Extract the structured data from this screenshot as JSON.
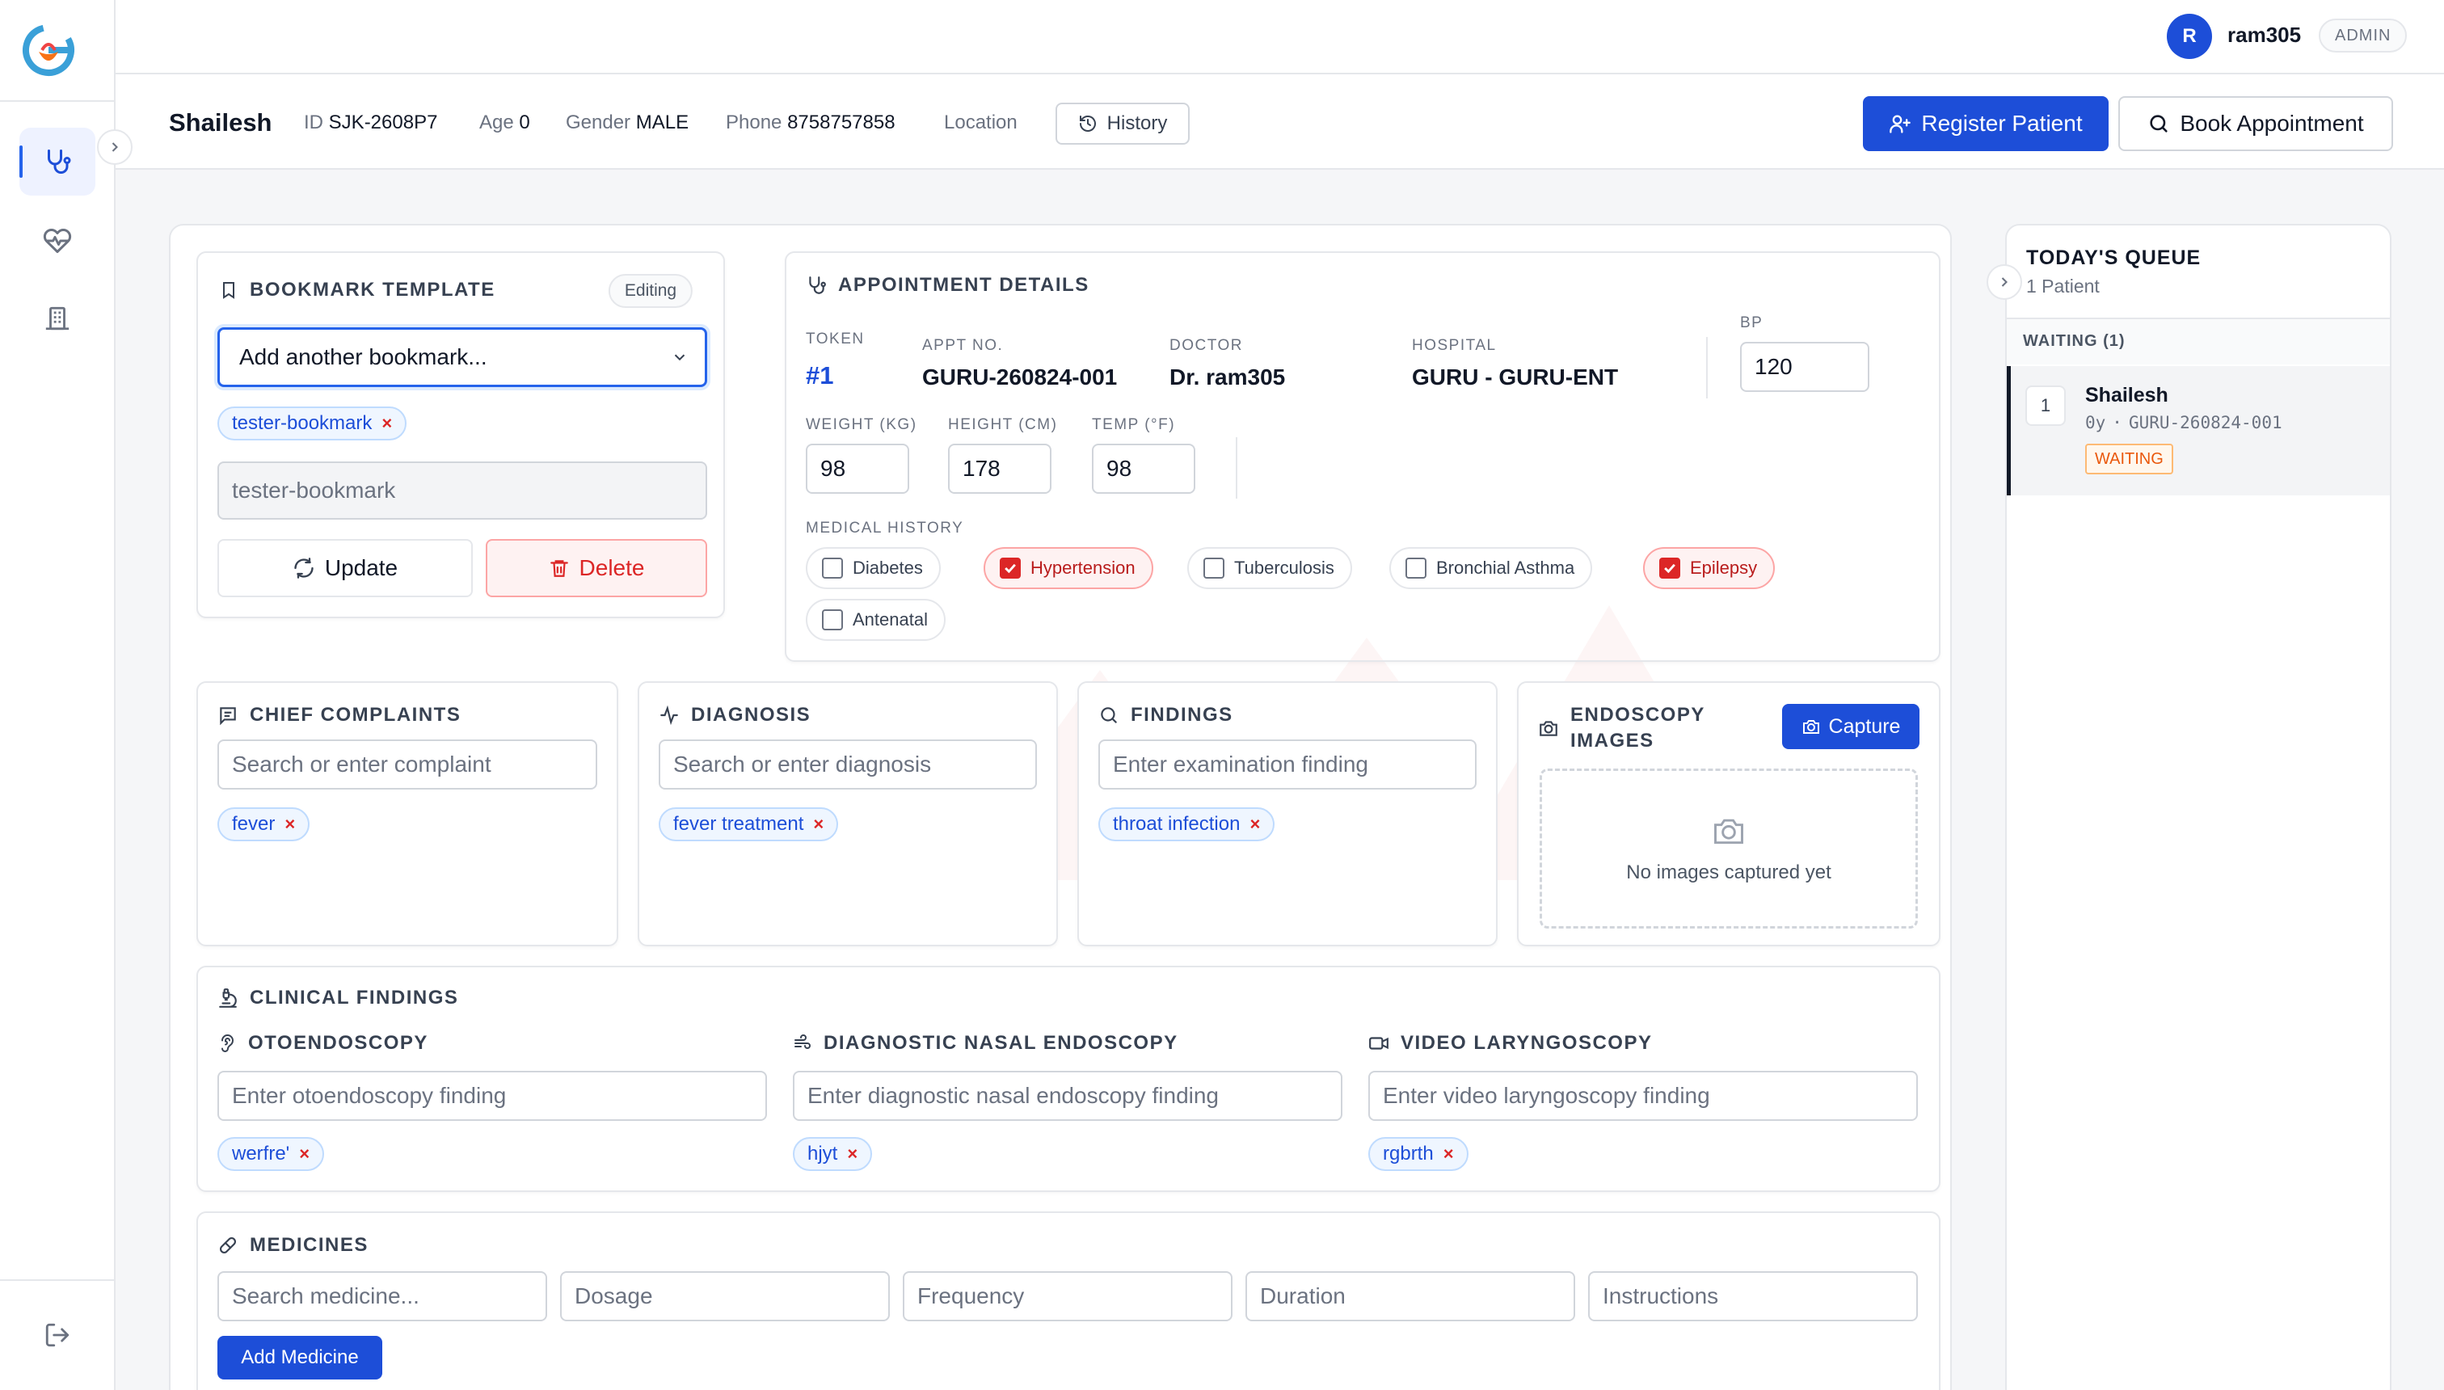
{
  "topbar": {
    "avatar_initial": "R",
    "user_name": "ram305",
    "role": "ADMIN"
  },
  "patient": {
    "name": "Shailesh",
    "id_label": "ID",
    "id": "SJK-2608P7",
    "age_label": "Age",
    "age": "0",
    "gender_label": "Gender",
    "gender": "MALE",
    "phone_label": "Phone",
    "phone": "8758757858",
    "location_label": "Location",
    "history_btn": "History",
    "register_btn": "Register Patient",
    "book_btn": "Book Appointment"
  },
  "bookmark": {
    "title": "BOOKMARK TEMPLATE",
    "badge": "Editing",
    "select_value": "Add another bookmark...",
    "chip": "tester-bookmark",
    "name_value": "tester-bookmark",
    "update_btn": "Update",
    "delete_btn": "Delete"
  },
  "appointment": {
    "title": "APPOINTMENT DETAILS",
    "token_label": "TOKEN",
    "token": "#1",
    "appt_label": "APPT NO.",
    "appt_no": "GURU-260824-001",
    "doctor_label": "DOCTOR",
    "doctor": "Dr. ram305",
    "hospital_label": "HOSPITAL",
    "hospital": "GURU - GURU-ENT",
    "bp_label": "BP",
    "bp": "120",
    "weight_label": "WEIGHT (KG)",
    "weight": "98",
    "height_label": "HEIGHT (CM)",
    "height": "178",
    "temp_label": "TEMP (°F)",
    "temp": "98",
    "history_label": "MEDICAL HISTORY",
    "history": [
      {
        "label": "Diabetes",
        "checked": false
      },
      {
        "label": "Hypertension",
        "checked": true
      },
      {
        "label": "Tuberculosis",
        "checked": false
      },
      {
        "label": "Bronchial Asthma",
        "checked": false
      },
      {
        "label": "Epilepsy",
        "checked": true
      },
      {
        "label": "Antenatal",
        "checked": false
      }
    ]
  },
  "complaints": {
    "title": "CHIEF COMPLAINTS",
    "placeholder": "Search or enter complaint",
    "chip": "fever"
  },
  "diagnosis": {
    "title": "DIAGNOSIS",
    "placeholder": "Search or enter diagnosis",
    "chip": "fever treatment"
  },
  "findings": {
    "title": "FINDINGS",
    "placeholder": "Enter examination finding",
    "chip": "throat infection"
  },
  "endoscopy": {
    "title_line1": "ENDOSCOPY",
    "title_line2": "IMAGES",
    "capture_btn": "Capture",
    "empty_text": "No images captured yet"
  },
  "clinical": {
    "title": "CLINICAL FINDINGS",
    "oto_title": "OTOENDOSCOPY",
    "oto_placeholder": "Enter otoendoscopy finding",
    "oto_chip": "werfre'",
    "nasal_title": "DIAGNOSTIC NASAL ENDOSCOPY",
    "nasal_placeholder": "Enter diagnostic nasal endoscopy finding",
    "nasal_chip": "hjyt",
    "laryngo_title": "VIDEO LARYNGOSCOPY",
    "laryngo_placeholder": "Enter video laryngoscopy finding",
    "laryngo_chip": "rgbrth"
  },
  "medicines": {
    "title": "MEDICINES",
    "search_placeholder": "Search medicine...",
    "dosage_placeholder": "Dosage",
    "frequency_placeholder": "Frequency",
    "duration_placeholder": "Duration",
    "instructions_placeholder": "Instructions",
    "add_btn": "Add Medicine"
  },
  "queue": {
    "title": "TODAY'S QUEUE",
    "count": "1 Patient",
    "waiting_header": "WAITING (1)",
    "items": [
      {
        "number": "1",
        "name": "Shailesh",
        "age": "0y",
        "appt": "GURU-260824-001",
        "status": "WAITING"
      }
    ]
  },
  "colors": {
    "primary": "#1d4ed8",
    "danger": "#dc2626",
    "warning": "#ea580c"
  }
}
